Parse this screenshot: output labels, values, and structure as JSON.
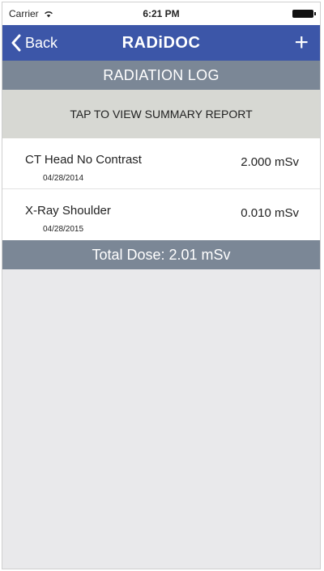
{
  "status_bar": {
    "carrier": "Carrier",
    "time": "6:21 PM"
  },
  "nav": {
    "back_label": "Back",
    "title": "RADiDOC",
    "add_label": "+"
  },
  "section_title": "RADIATION LOG",
  "summary_label": "TAP TO VIEW SUMMARY REPORT",
  "entries": [
    {
      "title": "CT Head No Contrast",
      "date": "04/28/2014",
      "dose": "2.000 mSv"
    },
    {
      "title": "X-Ray Shoulder",
      "date": "04/28/2015",
      "dose": "0.010 mSv"
    }
  ],
  "total_dose": "Total Dose: 2.01 mSv",
  "colors": {
    "nav_bg": "#3c56a8",
    "section_bg": "#7b8796",
    "summary_bg": "#d7d8d3"
  }
}
